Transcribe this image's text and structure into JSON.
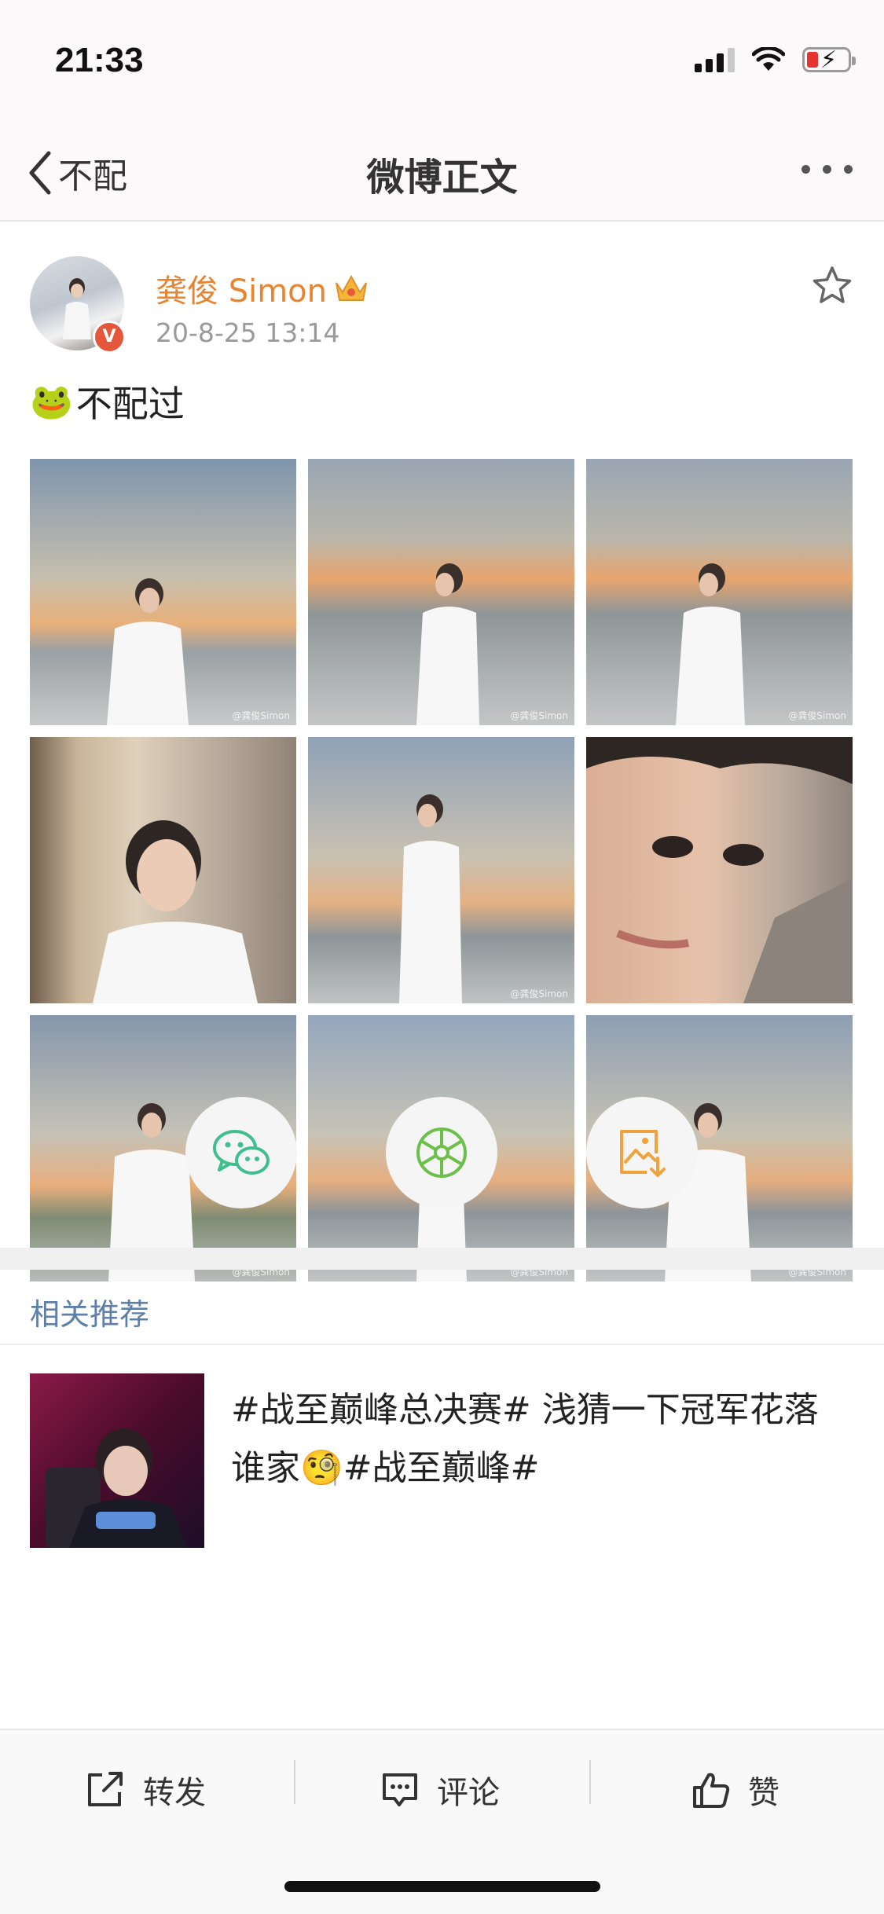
{
  "status_bar": {
    "time": "21:33"
  },
  "nav": {
    "back_label": "不配",
    "title": "微博正文"
  },
  "post": {
    "author": "龚俊 Simon",
    "time": "20-8-25 13:14",
    "text": "不配过",
    "photo_watermark": "@龚俊Simon"
  },
  "share": {
    "icons": [
      "wechat-icon",
      "moments-icon",
      "save-image-icon"
    ]
  },
  "related": {
    "title": "相关推荐",
    "item_text": "#战至巅峰总决赛# 浅猜一下冠军花落谁家🧐#战至巅峰#"
  },
  "actions": {
    "repost": "转发",
    "comment": "评论",
    "like": "赞"
  },
  "colors": {
    "author_name": "#e8842f",
    "related_title": "#5f7fa8",
    "wechat_green": "#3fbf8f",
    "save_orange": "#f0a23b"
  }
}
